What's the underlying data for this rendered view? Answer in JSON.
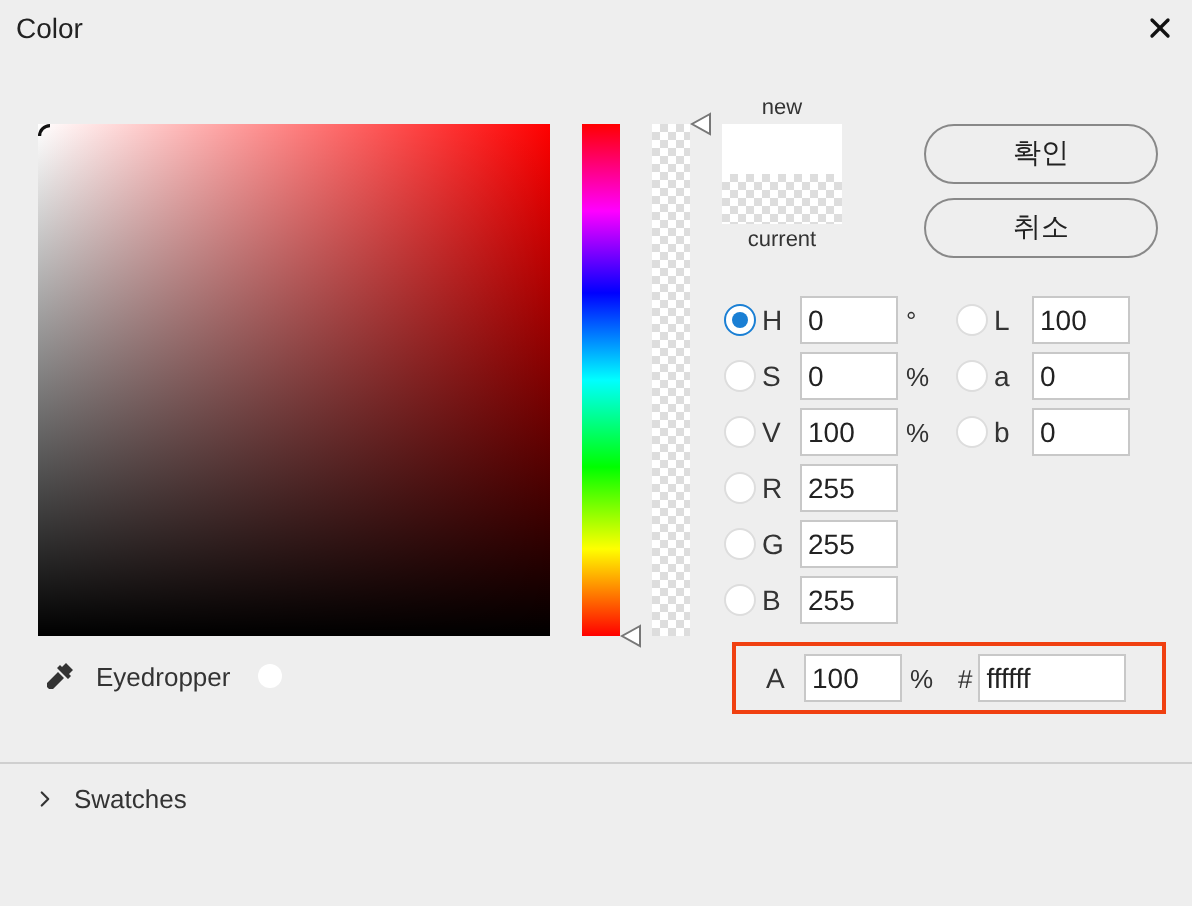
{
  "window": {
    "title": "Color"
  },
  "hue_slider": {
    "level": 0
  },
  "alpha_slider": {
    "level": 1
  },
  "preview": {
    "new_label": "new",
    "current_label": "current"
  },
  "buttons": [
    "확인",
    "취소"
  ],
  "channels_left": [
    {
      "label": "H",
      "value": "0",
      "unit": "°",
      "selected": true
    },
    {
      "label": "S",
      "value": "0",
      "unit": "%",
      "selected": false
    },
    {
      "label": "V",
      "value": "100",
      "unit": "%",
      "selected": false
    },
    {
      "label": "R",
      "value": "255",
      "selected": false
    },
    {
      "label": "G",
      "value": "255",
      "selected": false
    },
    {
      "label": "B",
      "value": "255",
      "selected": false
    }
  ],
  "channels_right": [
    {
      "label": "L",
      "value": "100",
      "selected": false
    },
    {
      "label": "a",
      "value": "0",
      "selected": false
    },
    {
      "label": "b",
      "value": "0",
      "selected": false
    }
  ],
  "alpha_row": {
    "label": "A",
    "value": "100",
    "unit": "%",
    "hash_label": "#",
    "hex": "ffffff",
    "highlighted": true
  },
  "eyedropper": {
    "label": "Eyedropper"
  },
  "swatches": {
    "label": "Swatches",
    "expanded": false
  }
}
